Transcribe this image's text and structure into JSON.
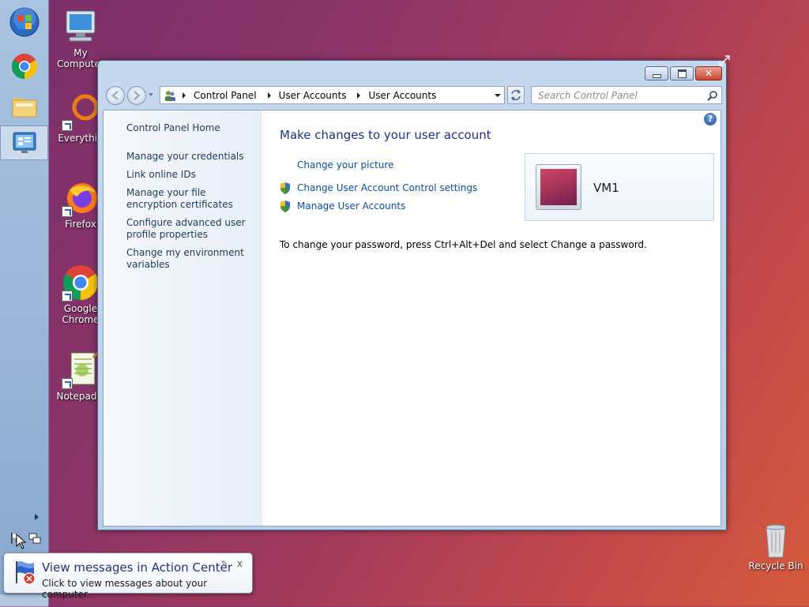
{
  "desktop": {
    "icons": [
      {
        "label": "My Computer"
      },
      {
        "label": "Everythin"
      },
      {
        "label": "Firefox"
      },
      {
        "label": "Google Chrome"
      },
      {
        "label": "Notepad+"
      },
      {
        "label": "Recycle Bin"
      }
    ]
  },
  "window": {
    "address": {
      "crumbs": [
        "Control Panel",
        "User Accounts",
        "User Accounts"
      ],
      "search_placeholder": "Search Control Panel"
    },
    "left_pane": {
      "home": "Control Panel Home",
      "links": [
        "Manage your credentials",
        "Link online IDs",
        "Manage your file encryption certificates",
        "Configure advanced user profile properties",
        "Change my environment variables"
      ]
    },
    "main": {
      "heading": "Make changes to your user account",
      "tasks": [
        "Change your picture",
        "Change User Account Control settings",
        "Manage User Accounts"
      ],
      "user": {
        "name": "VM1"
      },
      "password_note": "To change your password, press Ctrl+Alt+Del and select Change a password."
    },
    "help_label": "?"
  },
  "notification": {
    "title": "View messages in Action Center",
    "text": "Click to view messages about your computer.",
    "close_label": "x"
  },
  "colors": {
    "link": "#0b4fa8",
    "heading": "#1e3287",
    "nav_text": "#1e395b"
  }
}
